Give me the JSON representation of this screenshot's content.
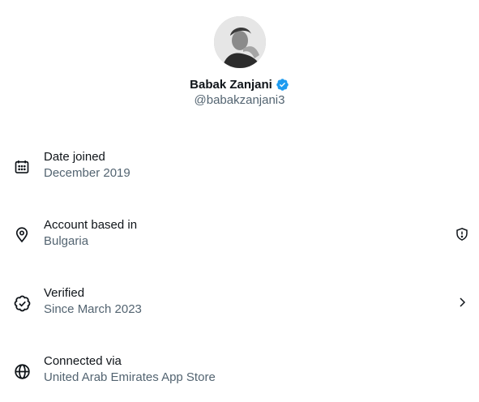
{
  "profile": {
    "name": "Babak Zanjani",
    "handle": "@babakzanjani3",
    "verified_color": "#1d9bf0"
  },
  "rows": [
    {
      "label": "Date joined",
      "value": "December 2019",
      "icon": "calendar-icon"
    },
    {
      "label": "Account based in",
      "value": "Bulgaria",
      "icon": "location-pin-icon",
      "trailing_icon": "shield-alert-icon"
    },
    {
      "label": "Verified",
      "value": "Since March 2023",
      "icon": "verified-check-icon",
      "trailing_icon": "chevron-right-icon"
    },
    {
      "label": "Connected via",
      "value": "United Arab Emirates App Store",
      "icon": "globe-icon"
    }
  ],
  "colors": {
    "primary_text": "#0f1419",
    "secondary_text": "#536471",
    "icon": "#0f1419"
  }
}
